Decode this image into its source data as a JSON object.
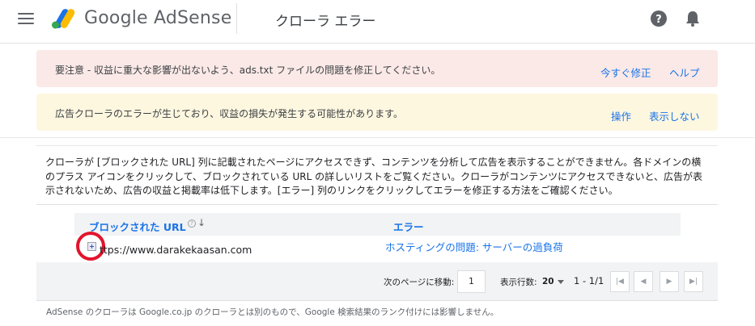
{
  "header": {
    "product_name": "Google AdSense",
    "page_title": "クローラ エラー",
    "icons": [
      "menu-icon",
      "adsense-logo",
      "help-icon",
      "bell-icon"
    ]
  },
  "alerts": {
    "warning": {
      "message": "要注意 - 収益に重大な影響が出ないよう、ads.txt ファイルの問題を修正してください。",
      "fix_now": "今すぐ修正",
      "help": "ヘルプ",
      "color": "#fbe9e7"
    },
    "crawler": {
      "message": "広告クローラのエラーが生じており、収益の損失が発生する可能性があります。",
      "action": "操作",
      "dismiss": "表示しない",
      "color": "#fef7e0"
    }
  },
  "content": {
    "description": "クローラが [ブロックされた URL] 列に記載されたページにアクセスできず、コンテンツを分析して広告を表示することができません。各ドメインの横のプラス アイコンをクリックして、ブロックされている URL の詳しいリストをご覧ください。クローラがコンテンツにアクセスできないと、広告が表示されないため、広告の収益と掲載率は低下します。[エラー] 列のリンクをクリックしてエラーを修正する方法をご確認ください。"
  },
  "table": {
    "columns": {
      "url": "ブロックされた URL",
      "error": "エラー",
      "help_mark": "?",
      "sort_arrow": "↓"
    },
    "rows": [
      {
        "url": "ttps://www.darakekaasan.com",
        "error": "ホスティングの問題: サーバーの過負荷"
      }
    ]
  },
  "pagination": {
    "goto_label": "次のページに移動:",
    "page_value": "1",
    "rows_label": "表示行数:",
    "rows_value": "20",
    "range": "1 - 1/1",
    "buttons": {
      "first": "|◀",
      "prev": "◀",
      "next": "▶",
      "last": "▶|"
    }
  },
  "footer": {
    "note": "AdSense のクローラは Google.co.jp のクローラとは別のもので、Google 検索結果のランク付けには影響しません。"
  },
  "colors": {
    "accent_blue": "#1a73e8",
    "highlight_red": "#e2142d"
  }
}
